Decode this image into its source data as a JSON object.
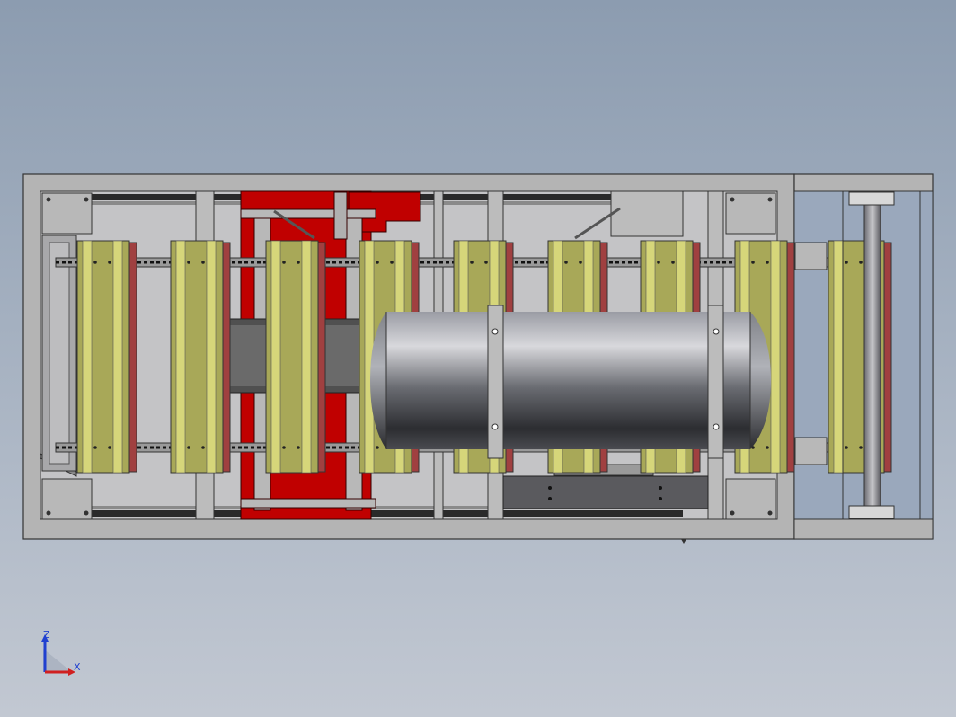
{
  "viewport": {
    "background_top": "#8c9cb0",
    "background_bottom": "#c2c8d2"
  },
  "model": {
    "frame_color": "#b4b4b4",
    "frame_edge": "#333333",
    "roller_color": "#a8a858",
    "roller_light": "#d6d67a",
    "red_part_color": "#c00000",
    "red_trim_color": "#a04040",
    "tank_color": "#606068",
    "roller_count_main": 8,
    "roller_count_side": 1
  },
  "triad": {
    "axis_z_label": "Z",
    "axis_x_label": "X",
    "axis_z_color": "#2040d0",
    "axis_x_color": "#d02020"
  }
}
